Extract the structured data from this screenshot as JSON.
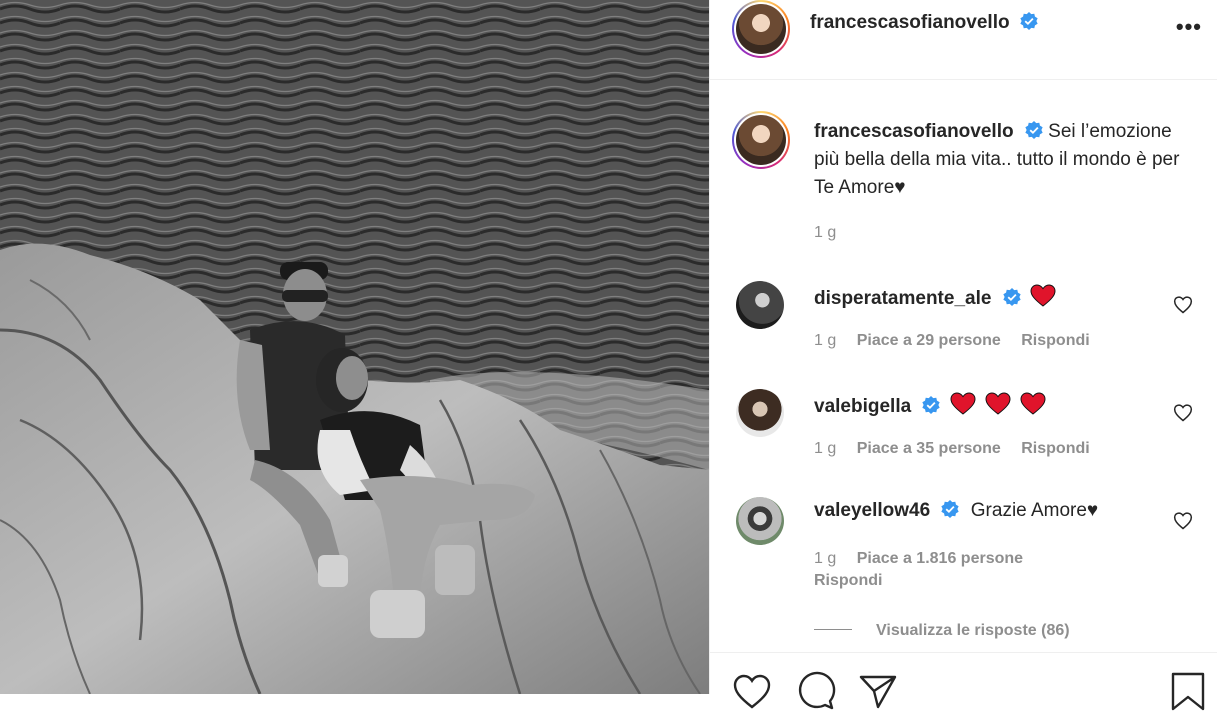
{
  "post": {
    "username": "francescasofianovello",
    "caption": "Sei l’emozione più bella della mia vita.. tutto il mondo è per Te Amore♥",
    "caption_time": "1 g",
    "more_label": "•••"
  },
  "comments": [
    {
      "username": "disperatamente_ale",
      "text": "",
      "hearts": 1,
      "time": "1 g",
      "likes": "Piace a 29 persone",
      "reply": "Rispondi"
    },
    {
      "username": "valebigella",
      "text": "",
      "hearts": 3,
      "time": "1 g",
      "likes": "Piace a 35 persone",
      "reply": "Rispondi"
    },
    {
      "username": "valeyellow46",
      "text": "Grazie Amore♥",
      "hearts": 0,
      "time": "1 g",
      "likes": "Piace a 1.816 persone",
      "reply": "Rispondi"
    }
  ],
  "view_replies": "Visualizza le risposte (86)",
  "colors": {
    "verified": "#3897f0",
    "heart_emoji": "#e0142b",
    "muted": "#8e8e8e",
    "text": "#262626"
  },
  "icons": [
    "verified-badge-icon",
    "heart-outline-icon",
    "comment-icon",
    "share-icon",
    "bookmark-icon",
    "more-options-icon"
  ]
}
